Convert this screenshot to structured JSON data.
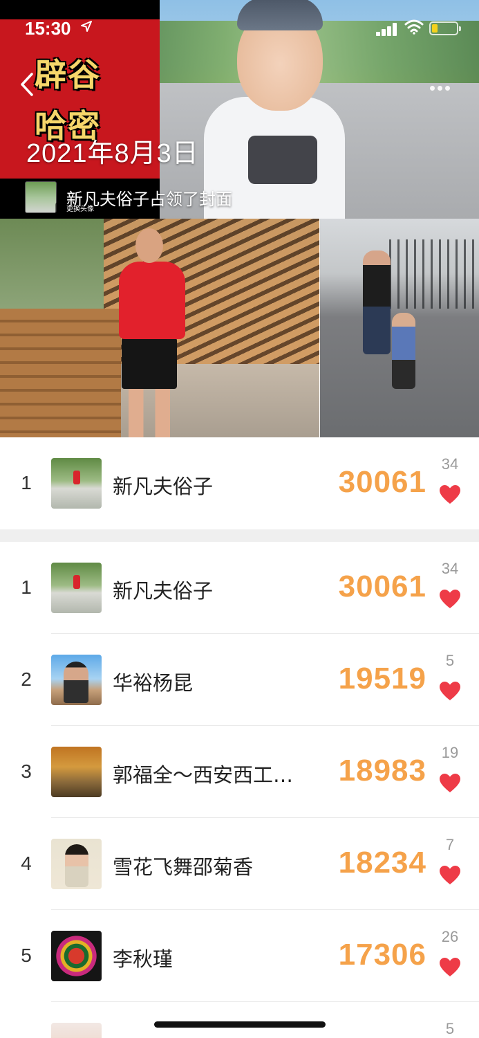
{
  "status_bar": {
    "time": "15:30",
    "battery_color": "#f3d21c"
  },
  "header": {
    "cover_text_line1": "辟谷",
    "cover_text_line2": "哈密",
    "date": "2021年8月3日",
    "cover_owner_caption": "更换头像",
    "cover_text": "新凡夫俗子占领了封面"
  },
  "my_rank": {
    "rank": "1",
    "name": "新凡夫俗子",
    "steps": "30061",
    "likes": "34"
  },
  "ranking": [
    {
      "rank": "1",
      "name": "新凡夫俗子",
      "steps": "30061",
      "likes": "34"
    },
    {
      "rank": "2",
      "name": "华裕杨昆",
      "steps": "19519",
      "likes": "5"
    },
    {
      "rank": "3",
      "name": "郭福全～西安西工…",
      "steps": "18983",
      "likes": "19"
    },
    {
      "rank": "4",
      "name": "雪花飞舞邵菊香",
      "steps": "18234",
      "likes": "7"
    },
    {
      "rank": "5",
      "name": "李秋瑾",
      "steps": "17306",
      "likes": "26"
    },
    {
      "rank": "",
      "name": "",
      "steps": "",
      "likes": "5"
    }
  ],
  "colors": {
    "accent_orange": "#f5a24a",
    "heart_red": "#ee3b47",
    "brand_red": "#c8171e"
  },
  "icons": {
    "back": "chevron-left-icon",
    "like": "heart-icon",
    "location": "location-arrow-icon"
  }
}
